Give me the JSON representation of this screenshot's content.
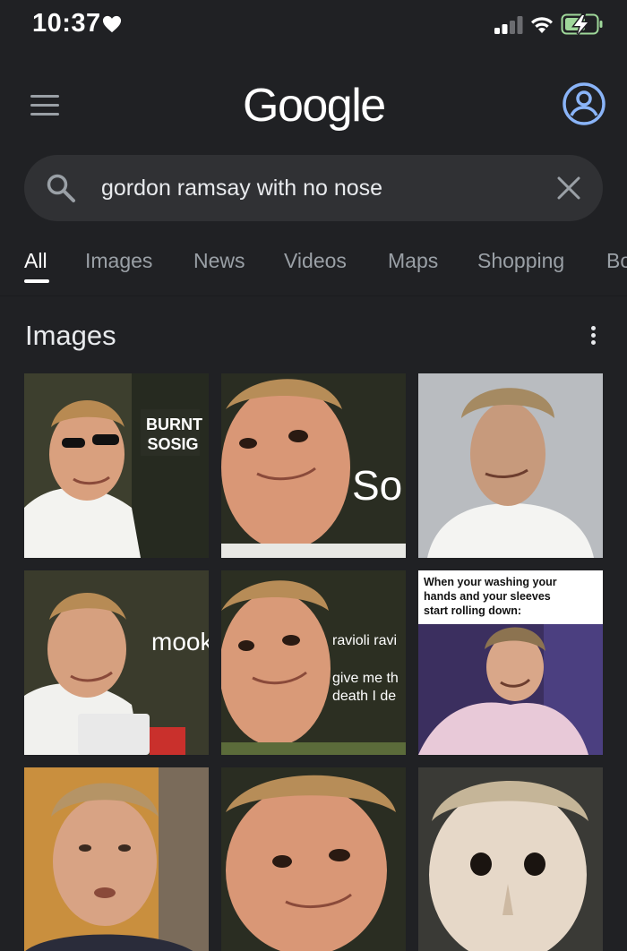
{
  "status_bar": {
    "time": "10:37",
    "heart_icon": "heart-icon",
    "signal_icon": "cell-signal-icon",
    "wifi_icon": "wifi-icon",
    "battery_icon": "battery-charging-icon"
  },
  "header": {
    "logo": "Google",
    "menu_icon": "hamburger-menu-icon",
    "account_icon": "account-circle-icon",
    "account_color": "#8ab4f8"
  },
  "search": {
    "query": "gordon ramsay with no nose",
    "search_icon": "search-icon",
    "clear_icon": "close-icon"
  },
  "tabs": [
    {
      "label": "All",
      "active": true
    },
    {
      "label": "Images",
      "active": false
    },
    {
      "label": "News",
      "active": false
    },
    {
      "label": "Videos",
      "active": false
    },
    {
      "label": "Maps",
      "active": false
    },
    {
      "label": "Shopping",
      "active": false
    },
    {
      "label": "Bo",
      "active": false
    }
  ],
  "images_section": {
    "title": "Images",
    "more_icon": "more-vert-icon",
    "results": [
      {
        "overlay_lines": [
          "BURNT",
          "SOSIG"
        ]
      },
      {
        "overlay_lines": [
          "So"
        ]
      },
      {
        "overlay_lines": []
      },
      {
        "overlay_lines": [
          "mook"
        ]
      },
      {
        "overlay_lines": [
          "ravioli ravi",
          "give me th",
          "death I de"
        ]
      },
      {
        "overlay_lines": [
          "When your washing your",
          "hands and your sleeves",
          "start rolling down:"
        ]
      },
      {
        "overlay_lines": []
      },
      {
        "overlay_lines": []
      },
      {
        "overlay_lines": []
      }
    ]
  }
}
